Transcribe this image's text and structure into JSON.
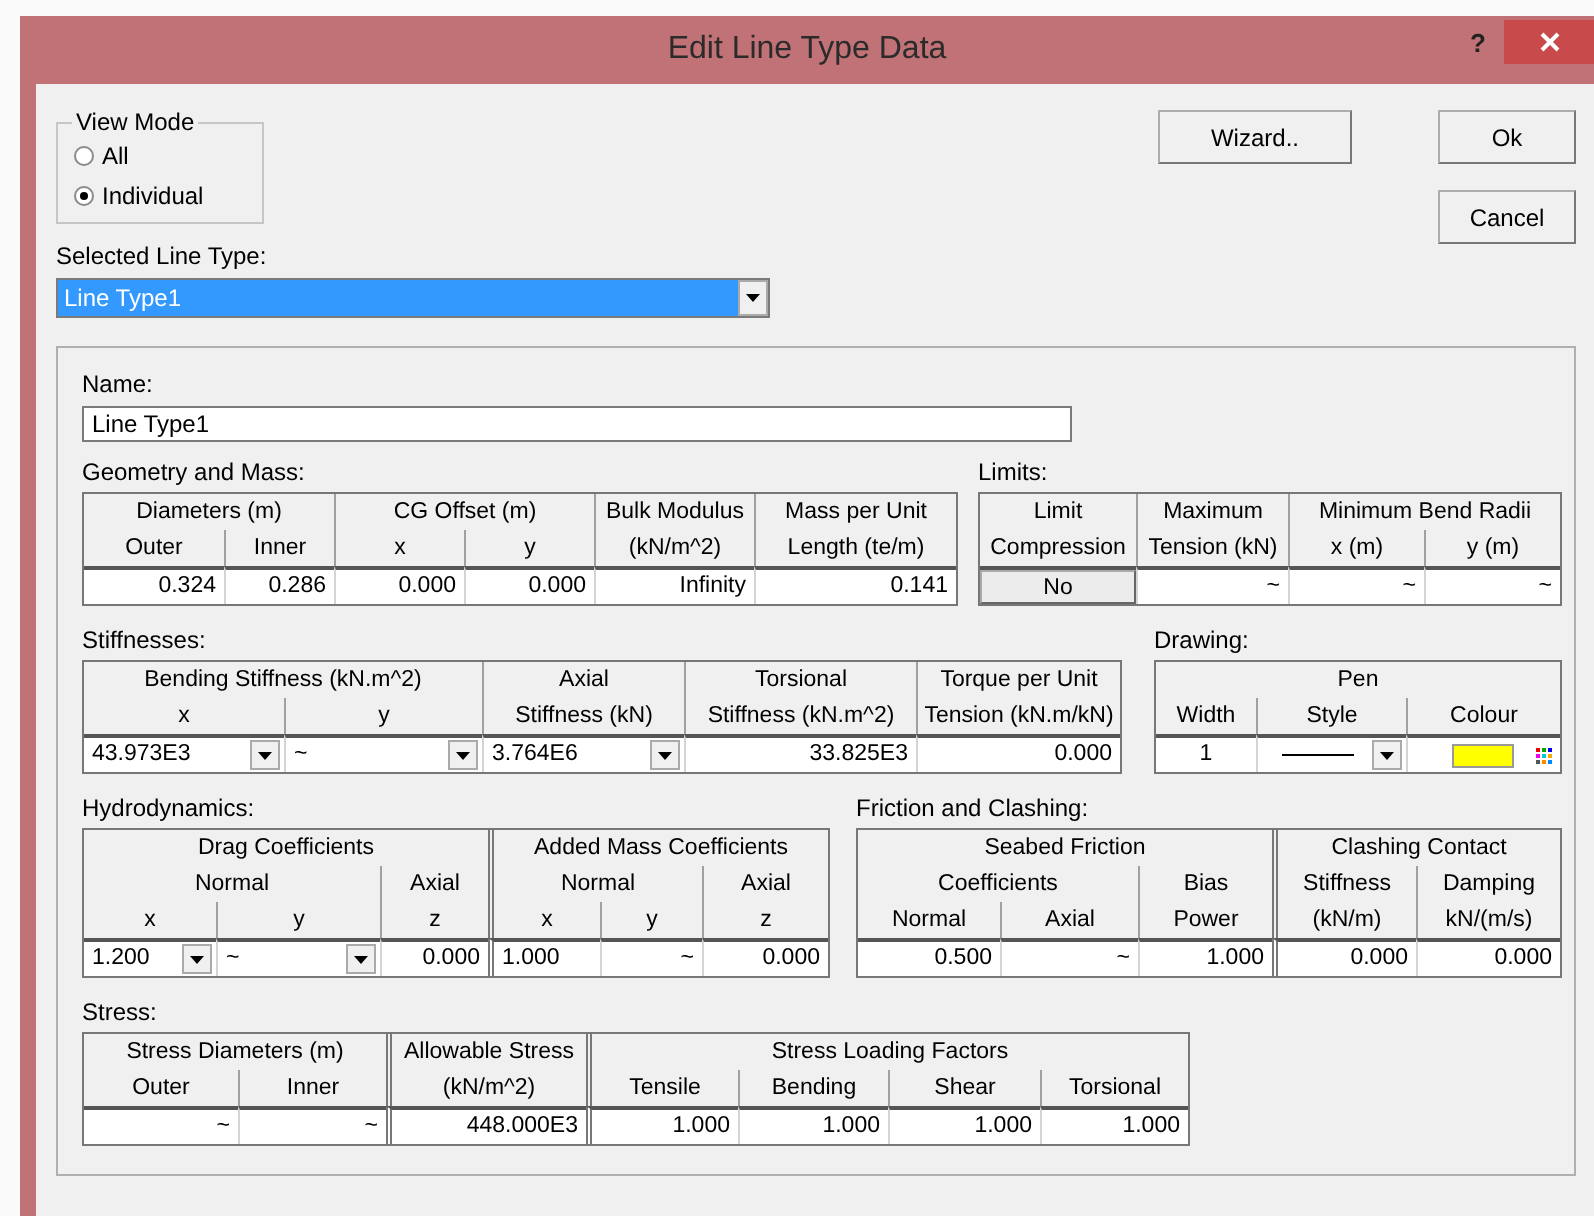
{
  "window": {
    "title": "Edit Line Type Data",
    "help": "?"
  },
  "view_mode": {
    "label": "View Mode",
    "options": [
      {
        "label": "All",
        "selected": false
      },
      {
        "label": "Individual",
        "selected": true
      }
    ]
  },
  "buttons": [
    {
      "label": "Wizard.."
    },
    {
      "label": "Ok"
    },
    {
      "label": "Cancel"
    }
  ],
  "selected_line_type": {
    "label": "Selected Line Type:",
    "value": "Line Type1"
  },
  "name": {
    "label": "Name:",
    "value": "Line Type1"
  },
  "tables": [
    {
      "kind": "geometry",
      "title": "Geometry and Mass:",
      "columns": [
        {
          "label": "Diameters (m)",
          "columns": [
            {
              "label": "Outer"
            },
            {
              "label": "Inner"
            }
          ]
        },
        {
          "label": "CG Offset (m)",
          "columns": [
            {
              "label": "x"
            },
            {
              "label": "y"
            }
          ]
        },
        {
          "label": "Bulk Modulus",
          "columns": [
            {
              "label": "(kN/m^2)"
            }
          ]
        },
        {
          "label": "Mass per Unit",
          "columns": [
            {
              "label": "Length (te/m)"
            }
          ]
        }
      ],
      "cells": [
        {
          "kind": "number",
          "value": "0.324"
        },
        {
          "kind": "number",
          "value": "0.286"
        },
        {
          "kind": "number",
          "value": "0.000"
        },
        {
          "kind": "number",
          "value": "0.000"
        },
        {
          "kind": "number",
          "value": "Infinity"
        },
        {
          "kind": "number",
          "value": "0.141"
        }
      ]
    },
    {
      "kind": "limits",
      "title": "Limits:",
      "columns": [
        {
          "label": "Limit",
          "columns": [
            {
              "label": "Compression"
            }
          ]
        },
        {
          "label": "Maximum",
          "columns": [
            {
              "label": "Tension (kN)"
            }
          ]
        },
        {
          "label": "Minimum Bend Radii",
          "columns": [
            {
              "label": "x (m)"
            },
            {
              "label": "y (m)"
            }
          ]
        }
      ],
      "cells": [
        {
          "kind": "toggle",
          "value": "No"
        },
        {
          "kind": "number",
          "value": "~"
        },
        {
          "kind": "number",
          "value": "~"
        },
        {
          "kind": "number",
          "value": "~"
        }
      ]
    },
    {
      "kind": "stiffnesses",
      "title": "Stiffnesses:",
      "columns": [
        {
          "label": "Bending Stiffness (kN.m^2)",
          "columns": [
            {
              "label": "x"
            },
            {
              "label": "y"
            }
          ]
        },
        {
          "label": "Axial",
          "columns": [
            {
              "label": "Stiffness (kN)"
            }
          ]
        },
        {
          "label": "Torsional",
          "columns": [
            {
              "label": "Stiffness (kN.m^2)"
            }
          ]
        },
        {
          "label": "Torque per Unit",
          "columns": [
            {
              "label": "Tension (kN.m/kN)"
            }
          ]
        }
      ],
      "cells": [
        {
          "kind": "combo",
          "value": "43.973E3"
        },
        {
          "kind": "combo",
          "value": "~"
        },
        {
          "kind": "combo",
          "value": "3.764E6"
        },
        {
          "kind": "number",
          "value": "33.825E3"
        },
        {
          "kind": "number",
          "value": "0.000"
        }
      ]
    },
    {
      "kind": "drawing",
      "title": "Drawing:",
      "columns": [
        {
          "label": "Pen",
          "columns": [
            {
              "label": "Width"
            },
            {
              "label": "Style"
            },
            {
              "label": "Colour"
            }
          ]
        }
      ],
      "cells": [
        {
          "kind": "centered_value",
          "value": "1"
        },
        {
          "kind": "line_style"
        },
        {
          "kind": "colour",
          "color": "#ffff00"
        }
      ]
    },
    {
      "kind": "hydrodynamics",
      "title": "Hydrodynamics:",
      "columns": [
        {
          "label": "Drag Coefficients",
          "columns": [
            {
              "label": "Normal",
              "columns": [
                {
                  "label": "x"
                },
                {
                  "label": "y"
                }
              ]
            },
            {
              "label": "Axial",
              "columns": [
                {
                  "label": "z"
                }
              ]
            }
          ]
        },
        {
          "label": "Added Mass Coefficients",
          "double_left": true,
          "columns": [
            {
              "label": "Normal",
              "columns": [
                {
                  "label": "x"
                },
                {
                  "label": "y"
                }
              ]
            },
            {
              "label": "Axial",
              "columns": [
                {
                  "label": "z"
                }
              ]
            }
          ]
        }
      ],
      "cells": [
        {
          "kind": "combo",
          "value": "1.200"
        },
        {
          "kind": "combo",
          "value": "~"
        },
        {
          "kind": "number",
          "value": "0.000"
        },
        {
          "kind": "left_value",
          "value": "1.000"
        },
        {
          "kind": "number",
          "value": "~"
        },
        {
          "kind": "number",
          "value": "0.000"
        }
      ]
    },
    {
      "kind": "friction",
      "title": "Friction and Clashing:",
      "columns": [
        {
          "label": "Seabed Friction",
          "columns": [
            {
              "label": "Coefficients",
              "columns": [
                {
                  "label": "Normal"
                },
                {
                  "label": "Axial"
                }
              ]
            },
            {
              "label": "Bias",
              "columns": [
                {
                  "label": "Power"
                }
              ]
            }
          ]
        },
        {
          "label": "Clashing Contact",
          "double_left": true,
          "columns": [
            {
              "label": "Stiffness",
              "columns": [
                {
                  "label": "(kN/m)"
                }
              ]
            },
            {
              "label": "Damping",
              "columns": [
                {
                  "label": "kN/(m/s)"
                }
              ]
            }
          ]
        }
      ],
      "cells": [
        {
          "kind": "number",
          "value": "0.500"
        },
        {
          "kind": "number",
          "value": "~"
        },
        {
          "kind": "number",
          "value": "1.000"
        },
        {
          "kind": "number",
          "value": "0.000"
        },
        {
          "kind": "number",
          "value": "0.000"
        }
      ]
    },
    {
      "kind": "stress",
      "title": "Stress:",
      "columns": [
        {
          "label": "Stress Diameters (m)",
          "columns": [
            {
              "label": "Outer"
            },
            {
              "label": "Inner"
            }
          ]
        },
        {
          "label": "Allowable Stress",
          "double_left": true,
          "columns": [
            {
              "label": "(kN/m^2)"
            }
          ]
        },
        {
          "label": "Stress Loading Factors",
          "double_left": true,
          "columns": [
            {
              "label": "Tensile"
            },
            {
              "label": "Bending"
            },
            {
              "label": "Shear"
            },
            {
              "label": "Torsional"
            }
          ]
        }
      ],
      "cells": [
        {
          "kind": "number",
          "value": "~"
        },
        {
          "kind": "number",
          "value": "~"
        },
        {
          "kind": "number",
          "value": "448.000E3"
        },
        {
          "kind": "number",
          "value": "1.000"
        },
        {
          "kind": "number",
          "value": "1.000"
        },
        {
          "kind": "number",
          "value": "1.000"
        },
        {
          "kind": "number",
          "value": "1.000"
        }
      ]
    }
  ]
}
